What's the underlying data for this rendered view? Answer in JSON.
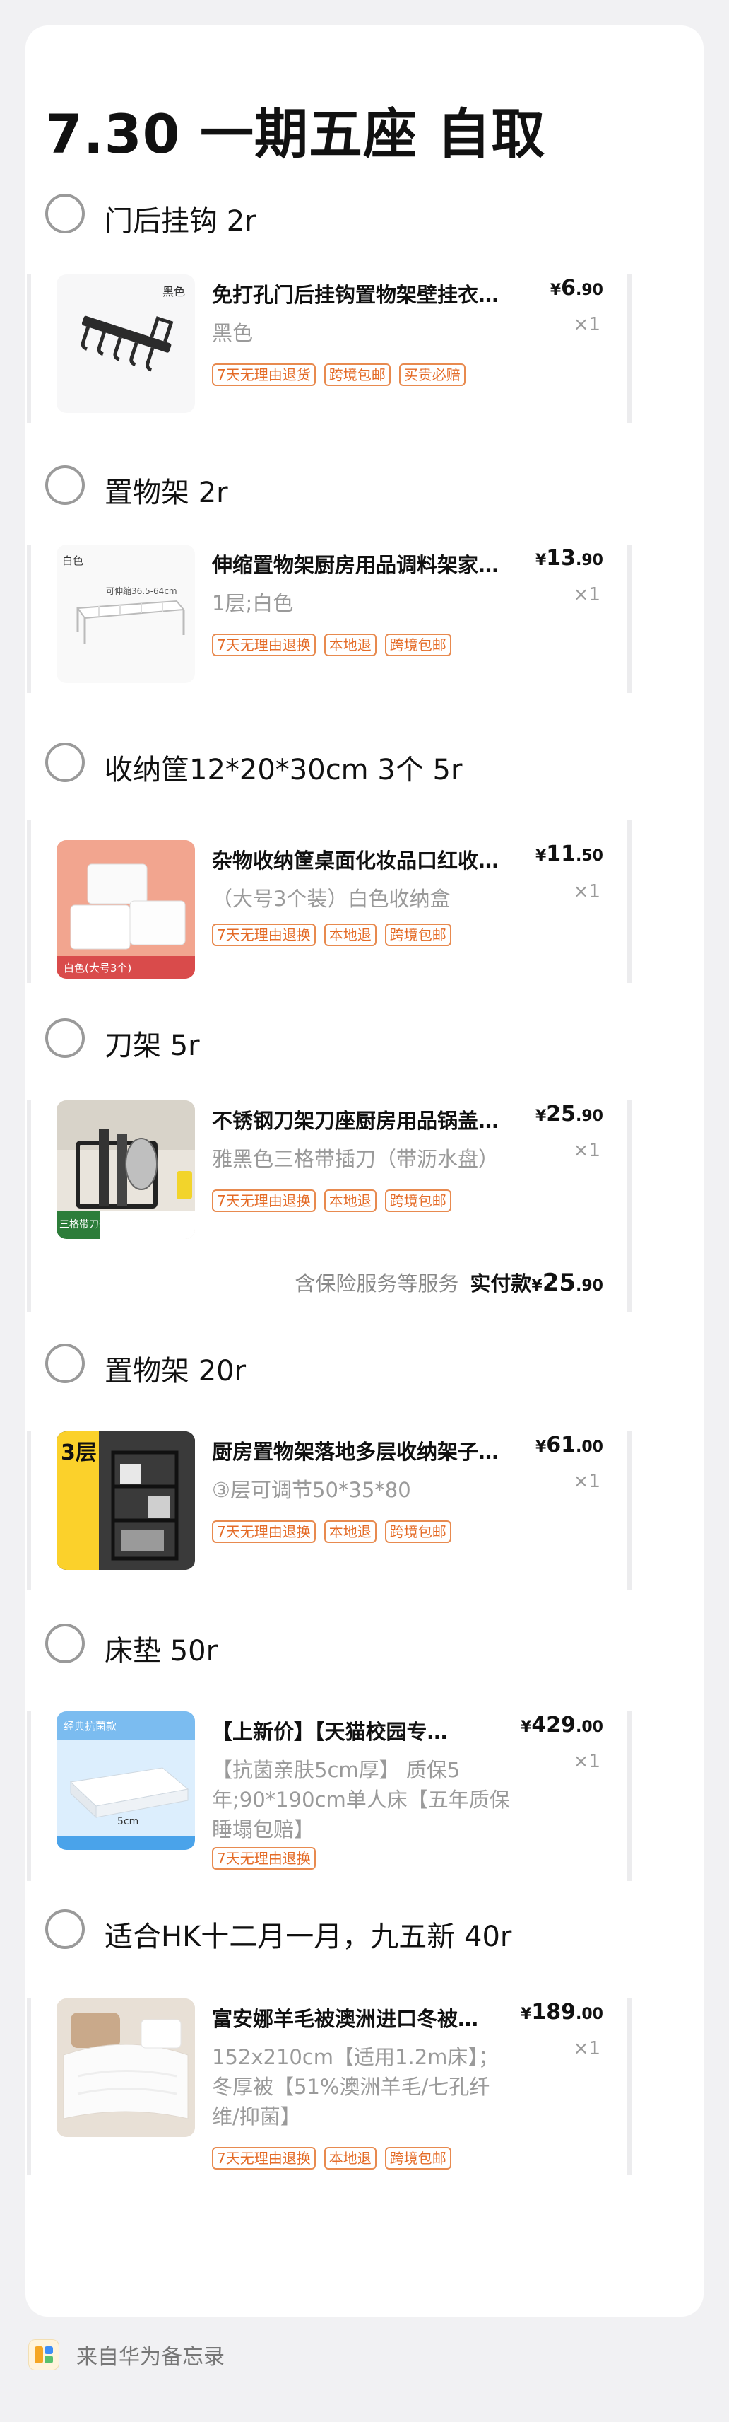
{
  "note": {
    "title": "7.30 一期五座 自取",
    "footer_source": "来自华为备忘录"
  },
  "sections": [
    {
      "check_label": "门后挂钩 2r",
      "product": {
        "name": "免打孔门后挂钩置物架壁挂衣…",
        "spec": "黑色",
        "price_symbol": "¥",
        "price_int": "6",
        "price_dec": ".90",
        "qty": "×1",
        "tags": [
          "7天无理由退货",
          "跨境包邮",
          "买贵必赔"
        ],
        "image_caption": "黑色"
      }
    },
    {
      "check_label": "置物架 2r",
      "product": {
        "name": "伸缩置物架厨房用品调料架家…",
        "spec": "1层;白色",
        "price_symbol": "¥",
        "price_int": "13",
        "price_dec": ".90",
        "qty": "×1",
        "tags": [
          "7天无理由退换",
          "本地退",
          "跨境包邮"
        ],
        "image_caption": "白色",
        "image_note": "可伸缩36.5-64cm"
      }
    },
    {
      "check_label": "收纳筐12*20*30cm   3个    5r",
      "product": {
        "name": "杂物收纳筐桌面化妆品口红收…",
        "spec": "（大号3个装）白色收纳盒",
        "price_symbol": "¥",
        "price_int": "11",
        "price_dec": ".50",
        "qty": "×1",
        "tags": [
          "7天无理由退换",
          "本地退",
          "跨境包邮"
        ],
        "image_caption": "白色(大号3个)"
      }
    },
    {
      "check_label": "刀架 5r",
      "product": {
        "name": "不锈钢刀架刀座厨房用品锅盖…",
        "spec": "雅黑色三格带插刀（带沥水盘）",
        "price_symbol": "¥",
        "price_int": "25",
        "price_dec": ".90",
        "qty": "×1",
        "tags": [
          "7天无理由退换",
          "本地退",
          "跨境包邮"
        ],
        "image_caption": "三格带刀架"
      },
      "total": {
        "service": "含保险服务等服务",
        "label": "实付款",
        "symbol": "¥",
        "int": "25",
        "dec": ".90"
      }
    },
    {
      "check_label": "置物架 20r",
      "product": {
        "name": "厨房置物架落地多层收纳架子…",
        "spec": "③层可调节50*35*80",
        "price_symbol": "¥",
        "price_int": "61",
        "price_dec": ".00",
        "qty": "×1",
        "tags": [
          "7天无理由退换",
          "本地退",
          "跨境包邮"
        ],
        "image_caption": "3层"
      }
    },
    {
      "check_label": "床垫 50r",
      "product": {
        "name": "【上新价】【天猫校园专…",
        "spec": "【抗菌亲肤5cm厚】        质保5年;90*190cm单人床【五年质保 睡塌包赔】",
        "price_symbol": "¥",
        "price_int": "429",
        "price_dec": ".00",
        "qty": "×1",
        "tags": [
          "7天无理由退换"
        ],
        "image_caption": "经典抗菌款",
        "image_note": "5cm"
      }
    },
    {
      "check_label": "适合HK十二月一月，九五新 40r",
      "product": {
        "name": "富安娜羊毛被澳洲进口冬被…",
        "spec": "152x210cm【适用1.2m床】；冬厚被【51%澳洲羊毛/七孔纤维/抑菌】",
        "price_symbol": "¥",
        "price_int": "189",
        "price_dec": ".00",
        "qty": "×1",
        "tags": [
          "7天无理由退换",
          "本地退",
          "跨境包邮"
        ]
      }
    }
  ]
}
